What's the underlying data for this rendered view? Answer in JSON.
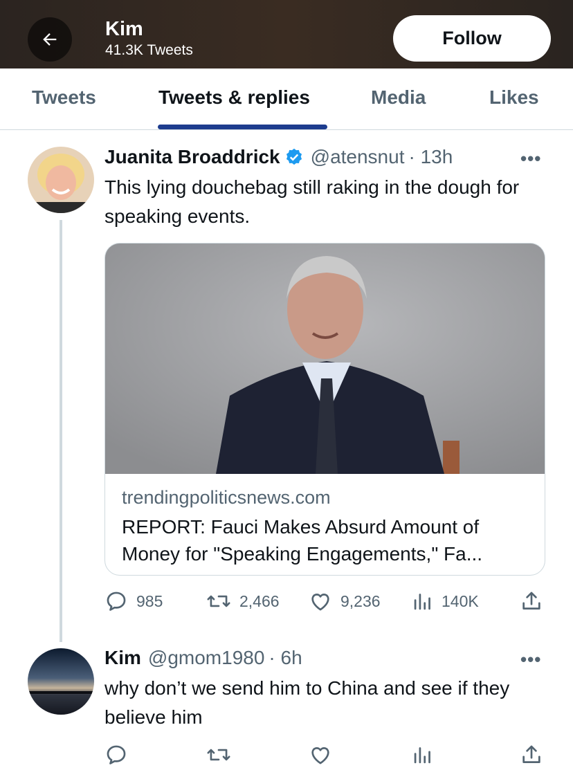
{
  "header": {
    "name": "Kim",
    "tweet_count": "41.3K Tweets",
    "follow_label": "Follow",
    "back_icon": "arrow-left-icon"
  },
  "tabs": [
    {
      "label": "Tweets",
      "active": false
    },
    {
      "label": "Tweets & replies",
      "active": true
    },
    {
      "label": "Media",
      "active": false
    },
    {
      "label": "Likes",
      "active": false
    }
  ],
  "tweets": [
    {
      "display_name": "Juanita Broaddrick",
      "verified": true,
      "handle": "@atensnut",
      "time": "· 13h",
      "more": "•••",
      "text": "This lying douchebag still raking in the dough for speaking events.",
      "card": {
        "domain": "trendingpoliticsnews.com",
        "title": "REPORT: Fauci Makes Absurd Amount of Money for \"Speaking Engagements,\" Fa..."
      },
      "stats": {
        "replies": "985",
        "retweets": "2,466",
        "likes": "9,236",
        "views": "140K"
      }
    },
    {
      "display_name": "Kim",
      "verified": false,
      "handle": "@gmom1980",
      "time": "· 6h",
      "more": "•••",
      "text": "why don’t we send him to China and see if they believe him",
      "stats": {
        "replies": "",
        "retweets": "",
        "likes": "",
        "views": ""
      }
    }
  ],
  "colors": {
    "accent_underline": "#1d3c8e",
    "verified": "#1d9bf0",
    "secondary_text": "#536471"
  }
}
